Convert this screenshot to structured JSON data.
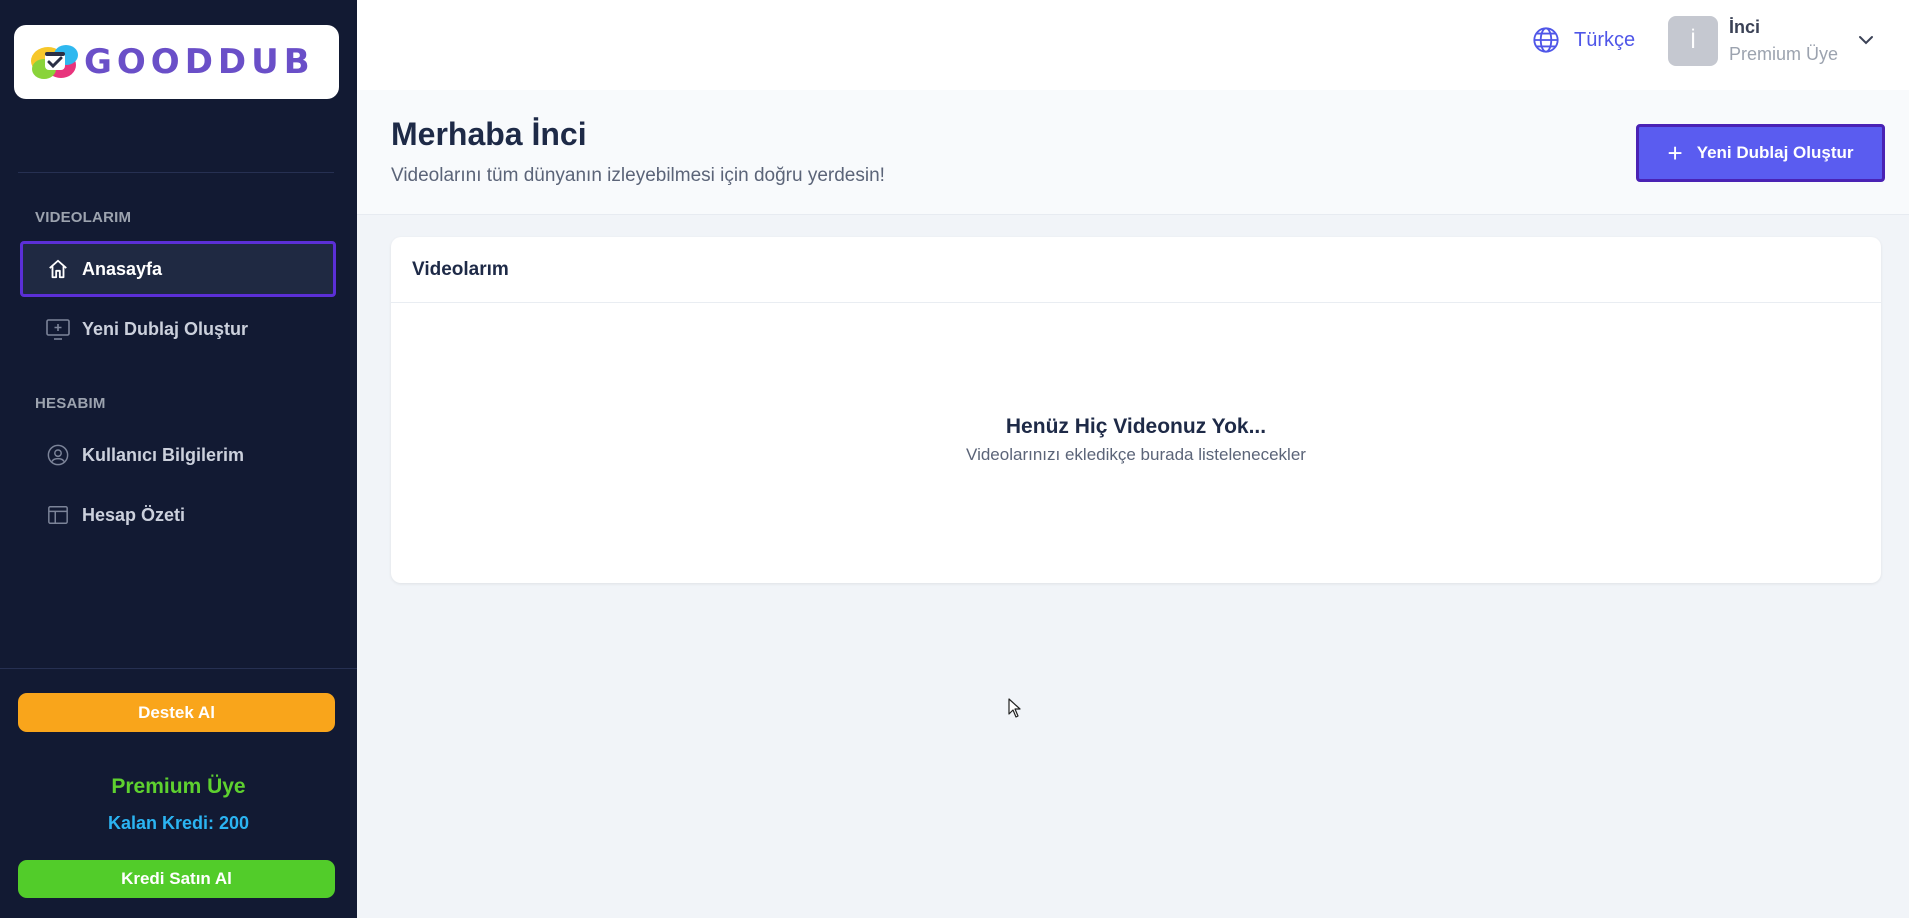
{
  "brand": {
    "name": "GOODDUB"
  },
  "sidebar": {
    "sections": [
      {
        "title": "VIDEOLARIM"
      },
      {
        "title": "HESABIM"
      }
    ],
    "items": [
      {
        "label": "Anasayfa",
        "icon": "home-icon",
        "active": true
      },
      {
        "label": "Yeni Dublaj Oluştur",
        "icon": "monitor-plus-icon"
      },
      {
        "label": "Kullanıcı Bilgilerim",
        "icon": "user-circle-icon"
      },
      {
        "label": "Hesap Özeti",
        "icon": "table-icon"
      }
    ],
    "support_button": "Destek Al",
    "membership": "Premium Üye",
    "credits": "Kalan Kredi: 200",
    "buy_button": "Kredi Satın Al"
  },
  "topbar": {
    "language": "Türkçe",
    "avatar_initial": "İ",
    "user_name": "İnci",
    "user_role": "Premium Üye"
  },
  "header": {
    "title": "Merhaba İnci",
    "subtitle": "Videolarını tüm dünyanın izleyebilmesi için doğru yerdesin!",
    "new_button": "Yeni Dublaj Oluştur"
  },
  "videos_card": {
    "title": "Videolarım",
    "empty_title": "Henüz Hiç Videonuz Yok...",
    "empty_subtitle": "Videolarınızı ekledikçe burada listelenecekler"
  },
  "colors": {
    "sidebar_bg": "#121a33",
    "accent": "#5a5cf0",
    "support": "#f9a51b",
    "buy": "#52cc2a",
    "premium": "#5ed12f",
    "credit": "#2bb4f2"
  }
}
